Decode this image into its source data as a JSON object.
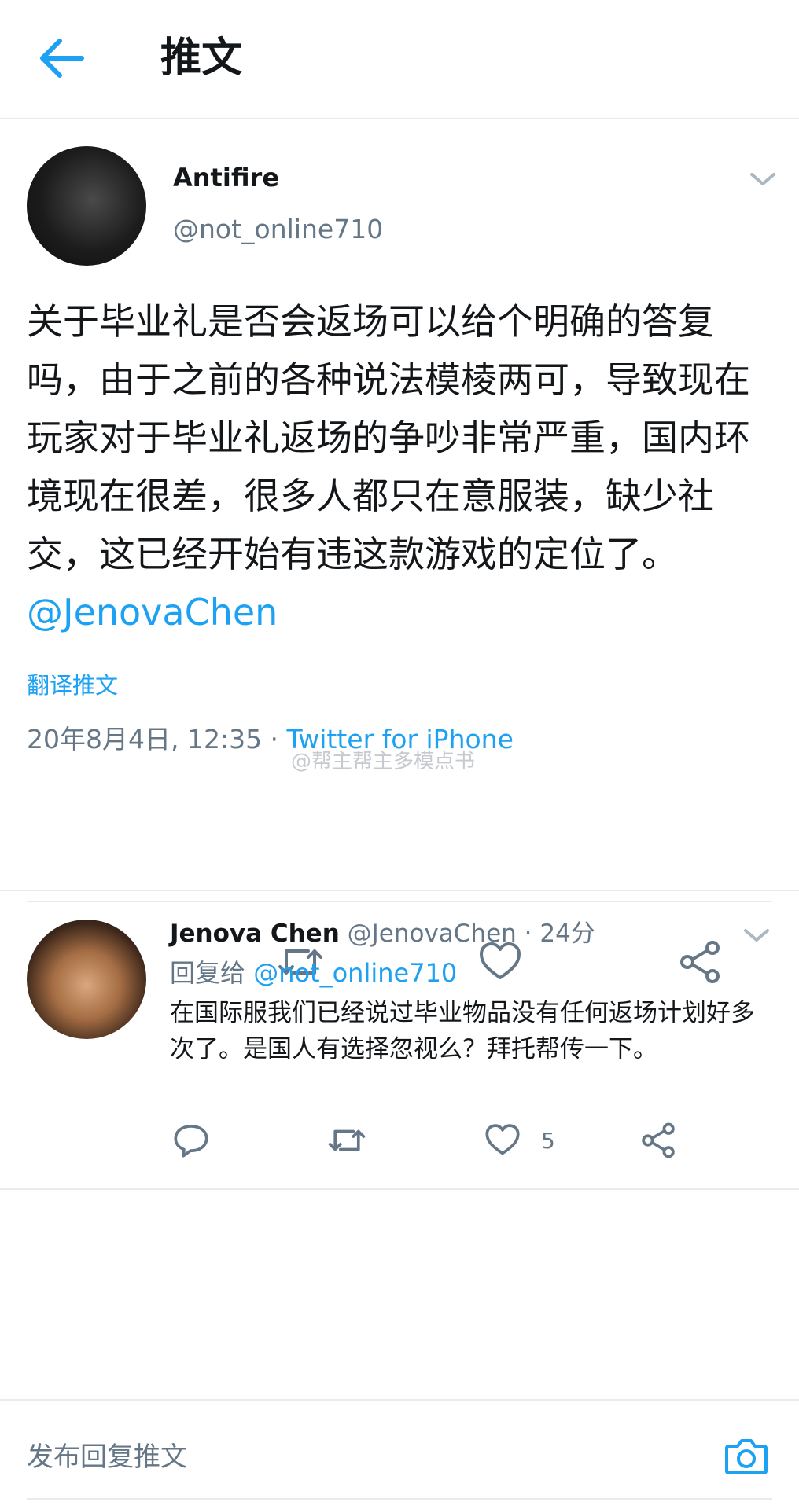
{
  "header": {
    "title": "推文"
  },
  "main_tweet": {
    "author_name": "Antifire",
    "author_handle": "@not_online710",
    "text": "关于毕业礼是否会返场可以给个明确的答复吗，由于之前的各种说法模棱两可，导致现在玩家对于毕业礼返场的争吵非常严重，国内环境现在很差，很多人都只在意服装，缺少社交，这已经开始有违这款游戏的定位了。",
    "mention": "@JenovaChen",
    "translate_label": "翻译推文",
    "timestamp": "20年8月4日, 12:35 · ",
    "source": "Twitter for iPhone",
    "watermark": "@帮主帮主多模点书"
  },
  "reply_tweet": {
    "author_name": "Jenova Chen",
    "author_handle": " @JenovaChen · 24分",
    "reply_to_prefix": "回复给 ",
    "reply_to_handle": "@not_online710",
    "text": "在国际服我们已经说过毕业物品没有任何返场计划好多次了。是国人有选择忽视么？拜托帮传一下。",
    "like_count": "5"
  },
  "compose": {
    "placeholder": "发布回复推文"
  },
  "colors": {
    "accent": "#1da1f2",
    "icon": "#657786",
    "text": "#14171a",
    "divider": "#e6ecf0"
  },
  "icons": [
    "back-arrow-icon",
    "chevron-down-icon",
    "reply-icon",
    "retweet-icon",
    "like-icon",
    "share-icon",
    "camera-icon"
  ]
}
